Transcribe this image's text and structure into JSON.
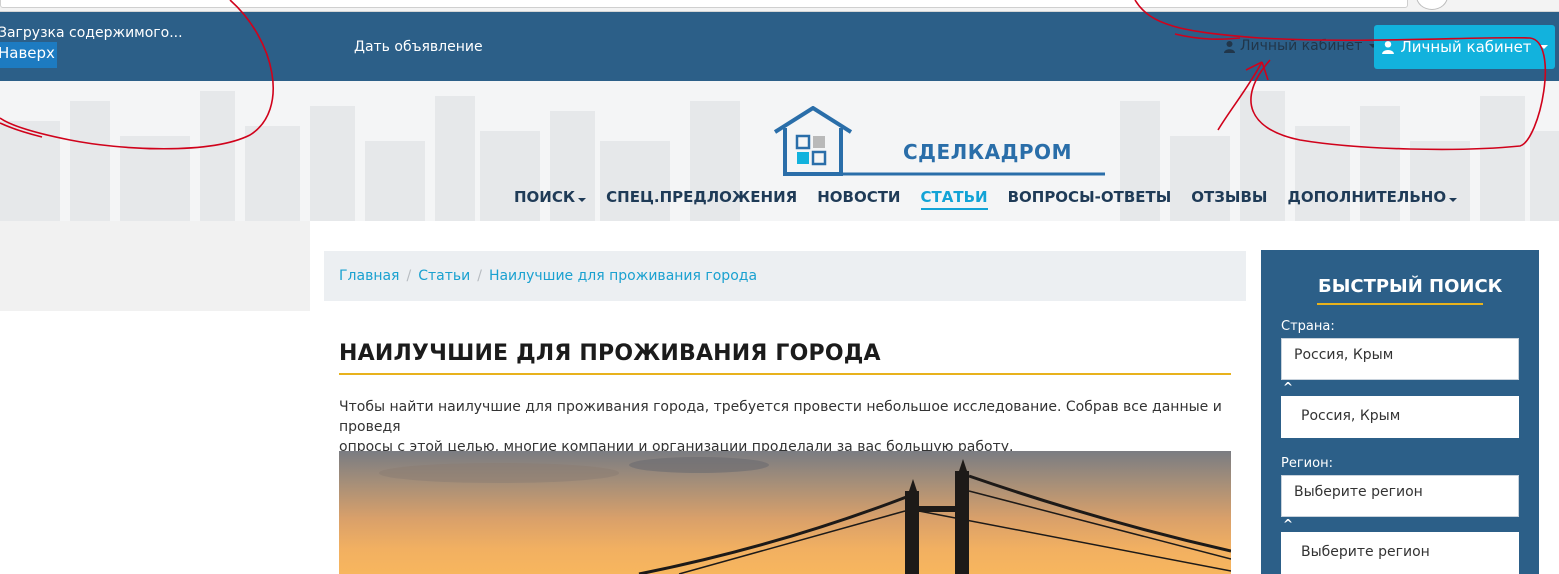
{
  "topbar": {
    "loading_text": "Загрузка содержимого...",
    "back_to_top": "Наверх",
    "post_ad": "Дать объявление",
    "cabinet_link": "Личный кабинет",
    "cabinet_button": "Личный кабинет"
  },
  "logo": {
    "text": "СДЕЛКАДРОМ"
  },
  "nav": {
    "items": [
      {
        "label": "ПОИСК",
        "dropdown": true
      },
      {
        "label": "СПЕЦ.ПРЕДЛОЖЕНИЯ"
      },
      {
        "label": "НОВОСТИ"
      },
      {
        "label": "СТАТЬИ",
        "active": true
      },
      {
        "label": "ВОПРОСЫ-ОТВЕТЫ"
      },
      {
        "label": "ОТЗЫВЫ"
      },
      {
        "label": "ДОПОЛНИТЕЛЬНО",
        "dropdown": true
      }
    ]
  },
  "breadcrumb": {
    "items": [
      "Главная",
      "Статьи",
      "Наилучшие для проживания города"
    ]
  },
  "article": {
    "title": "НАИЛУЧШИЕ ДЛЯ ПРОЖИВАНИЯ ГОРОДА",
    "intro_line1": "Чтобы найти наилучшие для проживания города, требуется провести небольшое исследование. Собрав все данные и проведя",
    "intro_line2": "опросы с этой целью, многие компании и организации проделали за вас большую работу."
  },
  "quick_search": {
    "title": "БЫСТРЫЙ ПОИСК",
    "country_label": "Страна:",
    "country_input": "Россия, Крым",
    "country_select": "Россия, Крым",
    "region_label": "Регион:",
    "region_input": "Выберите регион",
    "region_select": "Выберите регион",
    "toggle_glyph": "^"
  },
  "colors": {
    "topbar": "#2c5f88",
    "accent": "#12b2dd",
    "link": "#1aa1d0",
    "underline": "#e8b21d",
    "annotation": "#d0021b"
  }
}
